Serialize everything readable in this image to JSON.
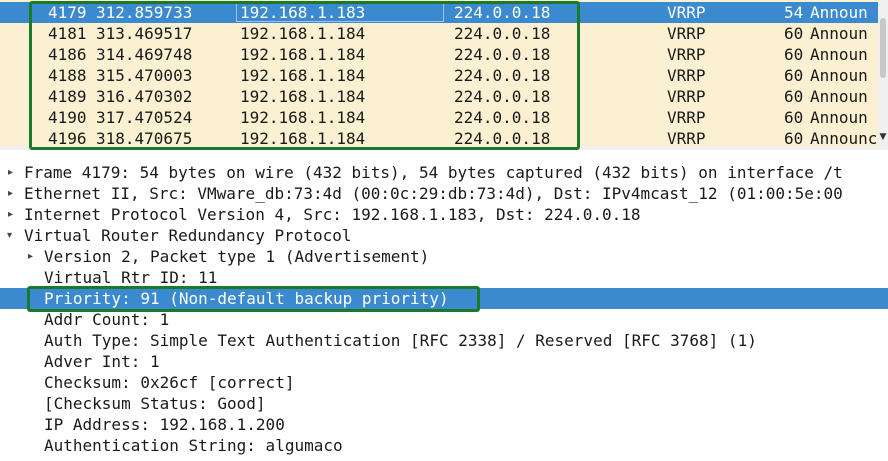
{
  "packet_list": {
    "rows": [
      {
        "no": "4179",
        "time": "312.859733",
        "src": "192.168.1.183",
        "dst": "224.0.0.18",
        "proto": "VRRP",
        "len": "54",
        "info": "Announ",
        "selected": true
      },
      {
        "no": "4181",
        "time": "313.469517",
        "src": "192.168.1.184",
        "dst": "224.0.0.18",
        "proto": "VRRP",
        "len": "60",
        "info": "Announ",
        "selected": false
      },
      {
        "no": "4186",
        "time": "314.469748",
        "src": "192.168.1.184",
        "dst": "224.0.0.18",
        "proto": "VRRP",
        "len": "60",
        "info": "Announ",
        "selected": false
      },
      {
        "no": "4188",
        "time": "315.470003",
        "src": "192.168.1.184",
        "dst": "224.0.0.18",
        "proto": "VRRP",
        "len": "60",
        "info": "Announ",
        "selected": false
      },
      {
        "no": "4189",
        "time": "316.470302",
        "src": "192.168.1.184",
        "dst": "224.0.0.18",
        "proto": "VRRP",
        "len": "60",
        "info": "Announ",
        "selected": false
      },
      {
        "no": "4190",
        "time": "317.470524",
        "src": "192.168.1.184",
        "dst": "224.0.0.18",
        "proto": "VRRP",
        "len": "60",
        "info": "Announ",
        "selected": false
      },
      {
        "no": "4196",
        "time": "318.470675",
        "src": "192.168.1.184",
        "dst": "224.0.0.18",
        "proto": "VRRP",
        "len": "60",
        "info": "Announc",
        "selected": false
      }
    ]
  },
  "details": {
    "frame": "Frame 4179: 54 bytes on wire (432 bits), 54 bytes captured (432 bits) on interface /t",
    "ethernet": "Ethernet II, Src: VMware_db:73:4d (00:0c:29:db:73:4d), Dst: IPv4mcast_12 (01:00:5e:00",
    "ip": "Internet Protocol Version 4, Src: 192.168.1.183, Dst: 224.0.0.18",
    "vrrp": "Virtual Router Redundancy Protocol",
    "version": "Version 2, Packet type 1 (Advertisement)",
    "vrid": "Virtual Rtr ID: 11",
    "priority": "Priority: 91 (Non-default backup priority)",
    "addr_count": "Addr Count: 1",
    "auth_type": "Auth Type: Simple Text Authentication [RFC 2338] / Reserved [RFC 3768] (1)",
    "adver_int": "Adver Int: 1",
    "checksum": "Checksum: 0x26cf [correct]",
    "checksum_status": "[Checksum Status: Good]",
    "ip_address": "IP Address: 192.168.1.200",
    "auth_string": "Authentication String: algumaco"
  },
  "colors": {
    "row_bg": "#fcf0d2",
    "selected": "#3b8ad0",
    "highlight_box": "#1a7a2a"
  }
}
